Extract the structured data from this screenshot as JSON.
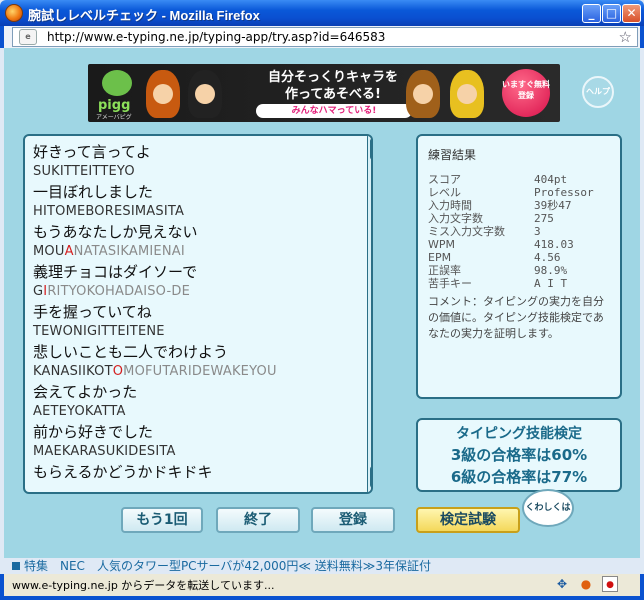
{
  "window": {
    "title": "腕試しレベルチェック - Mozilla Firefox"
  },
  "address": {
    "url": "http://www.e-typing.ne.jp/typing-app/try.asp?id=646583",
    "site_icon_text": "e"
  },
  "banner": {
    "brand": "pigg",
    "brand_sub": "アメーバピグ",
    "headline_1": "自分そっくりキャラを",
    "headline_2": "作ってあそべる!",
    "tag": "みんなハマっている!",
    "cta": "いますぐ無料登録"
  },
  "help": {
    "label": "ヘルプ"
  },
  "typing": {
    "lines": [
      {
        "jp": "好きって言ってよ",
        "ro_typed": "SUKITTEITTEYO",
        "ro_err": "",
        "ro_rest": ""
      },
      {
        "jp": "一目ぼれしました",
        "ro_typed": "HITOMEBORESIMASITA",
        "ro_err": "",
        "ro_rest": ""
      },
      {
        "jp": "もうあなたしか見えない",
        "ro_typed": "MOU",
        "ro_err": "A",
        "ro_rest": "NATASIKAMIENAI"
      },
      {
        "jp": "義理チョコはダイソーで",
        "ro_typed": "G",
        "ro_err": "I",
        "ro_rest": "RITYOKOHADAISO-DE"
      },
      {
        "jp": "手を握っていてね",
        "ro_typed": "TEWONIGITTEITENE",
        "ro_err": "",
        "ro_rest": ""
      },
      {
        "jp": "悲しいことも二人でわけよう",
        "ro_typed": "KANASIIKOT",
        "ro_err": "O",
        "ro_rest": "MOFUTARIDEWAKEYOU"
      },
      {
        "jp": "会えてよかった",
        "ro_typed": "AETEYOKATTA",
        "ro_err": "",
        "ro_rest": ""
      },
      {
        "jp": "前から好きでした",
        "ro_typed": "MAEKARASUKIDESITA",
        "ro_err": "",
        "ro_rest": ""
      },
      {
        "jp": "もらえるかどうかドキドキ",
        "ro_typed": "",
        "ro_err": "",
        "ro_rest": ""
      }
    ],
    "scroll_up": "▲",
    "scroll_down": "▼"
  },
  "results": {
    "title": "練習結果",
    "stats": [
      {
        "k": "スコア",
        "v": "404pt"
      },
      {
        "k": "レベル",
        "v": "Professor"
      },
      {
        "k": "入力時間",
        "v": "39秒47"
      },
      {
        "k": "入力文字数",
        "v": "275"
      },
      {
        "k": "ミス入力文字数",
        "v": "3"
      },
      {
        "k": "WPM",
        "v": "418.03"
      },
      {
        "k": "EPM",
        "v": "4.56"
      },
      {
        "k": "正誤率",
        "v": "98.9%"
      },
      {
        "k": "苦手キー",
        "v": "A I T"
      }
    ],
    "comment": "コメント：タイピングの実力を自分の価値に。タイピング技能検定であなたの実力を証明します。"
  },
  "cert": {
    "title": "タイピング技能検定",
    "line1": "3級の合格率は60%",
    "line2": "6級の合格率は77%"
  },
  "buttons": {
    "again": "もう1回",
    "end": "終了",
    "register": "登録",
    "exam": "検定試験",
    "details": "くわしくは"
  },
  "ticker": {
    "text": "特集　NEC　人気のタワー型PCサーバが42,000円≪ 送料無料≫3年保証付"
  },
  "status": {
    "text": "www.e-typing.ne.jp からデータを転送しています..."
  },
  "colors": {
    "panel_border": "#2a6f86",
    "content_bg": "#9fd6e4",
    "error": "#d42020"
  }
}
